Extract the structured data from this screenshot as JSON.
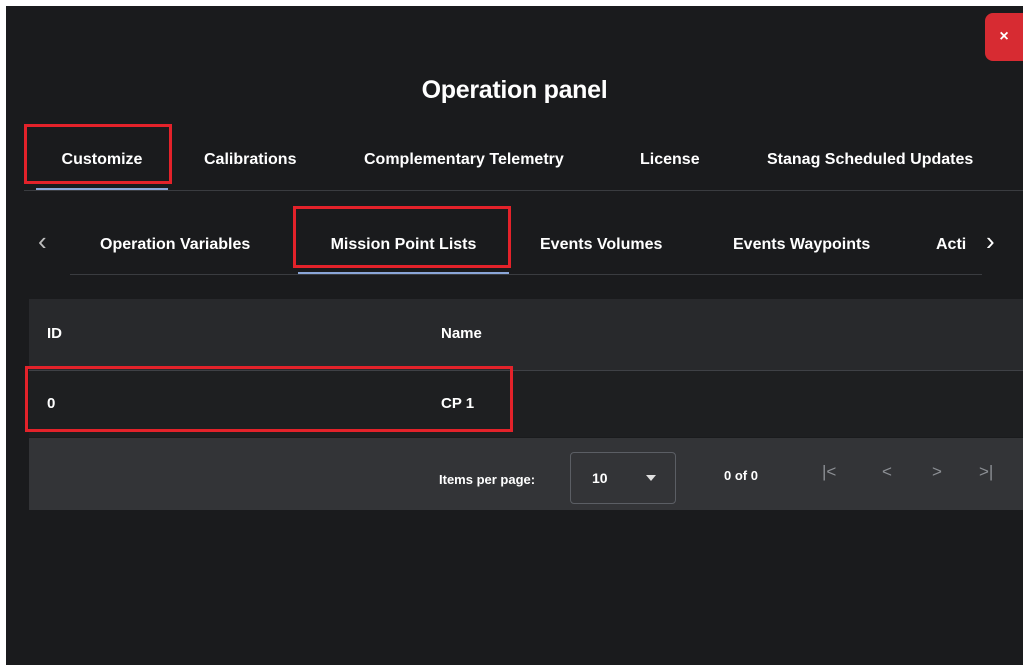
{
  "panel": {
    "title": "Operation panel",
    "close_label": "×"
  },
  "main_tabs": [
    {
      "label": "Customize",
      "active": true
    },
    {
      "label": "Calibrations",
      "active": false
    },
    {
      "label": "Complementary Telemetry",
      "active": false
    },
    {
      "label": "License",
      "active": false
    },
    {
      "label": "Stanag Scheduled Updates",
      "active": false
    }
  ],
  "sub_tabs": [
    {
      "label": "Operation Variables",
      "active": false
    },
    {
      "label": "Mission Point Lists",
      "active": true
    },
    {
      "label": "Events Volumes",
      "active": false
    },
    {
      "label": "Events Waypoints",
      "active": false
    },
    {
      "label": "Acti",
      "active": false
    }
  ],
  "sub_tabs_nav": {
    "prev": "‹",
    "next": "›"
  },
  "table": {
    "columns": [
      "ID",
      "Name"
    ],
    "rows": [
      {
        "id": "0",
        "name": "CP 1"
      }
    ]
  },
  "paginator": {
    "items_per_page_label": "Items per page:",
    "items_per_page_value": "10",
    "range_label": "0 of 0",
    "first": "|<",
    "prev": "<",
    "next": ">",
    "last": ">|"
  },
  "colors": {
    "background": "#1a1b1d",
    "close_button": "#d72b32",
    "highlight": "#e3222a",
    "active_tab_underline": "#8aa6d8"
  }
}
